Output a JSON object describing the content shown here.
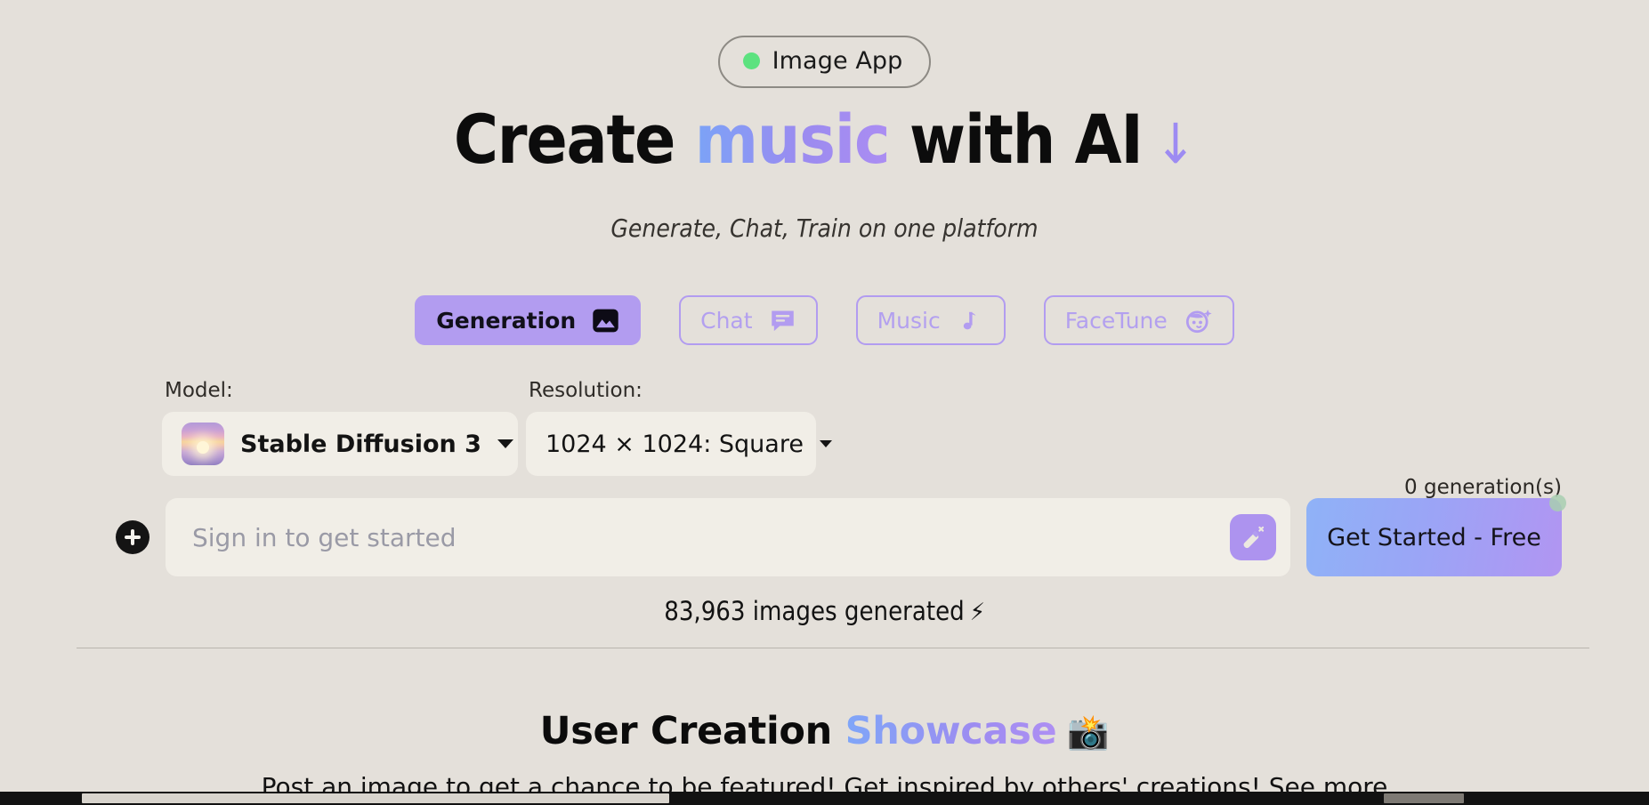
{
  "badge": {
    "label": "Image App",
    "dot_color": "#5ce27f",
    "dot_icon": "status-dot-icon"
  },
  "headline": {
    "part1": "Create",
    "highlight": "music",
    "part2": "with AI",
    "arrow": "↓"
  },
  "subtitle": "Generate, Chat, Train on one platform",
  "tabs": [
    {
      "label": "Generation",
      "icon": "image-icon",
      "active": true
    },
    {
      "label": "Chat",
      "icon": "chat-bubble-icon",
      "active": false
    },
    {
      "label": "Music",
      "icon": "music-note-icon",
      "active": false
    },
    {
      "label": "FaceTune",
      "icon": "face-sparkle-icon",
      "active": false
    }
  ],
  "controls": {
    "model": {
      "label": "Model:",
      "value": "Stable Diffusion 3",
      "thumb_icon": "sunset-thumbnail"
    },
    "resolution": {
      "label": "Resolution:",
      "value": "1024 × 1024: Square"
    }
  },
  "prompt": {
    "add_icon": "plus-icon",
    "placeholder": "Sign in to get started",
    "value": "",
    "enhance_icon": "magic-wand-icon"
  },
  "cta": {
    "label": "Get Started - Free",
    "generations": "0 generation(s)"
  },
  "stats": {
    "images_generated": "83,963 images generated",
    "bolt": "⚡"
  },
  "showcase": {
    "title_part1": "User Creation",
    "title_highlight": "Showcase",
    "camera": "📸",
    "sub_part1": "Post an image to get a chance to be featured! Get inspired by others' creations!",
    "see_more": "See more"
  },
  "colors": {
    "background": "#e4e0da",
    "accent_purple": "#b29cf0",
    "accent_blue": "#8fb2f7",
    "surface": "#f1eee7",
    "text": "#121212"
  }
}
